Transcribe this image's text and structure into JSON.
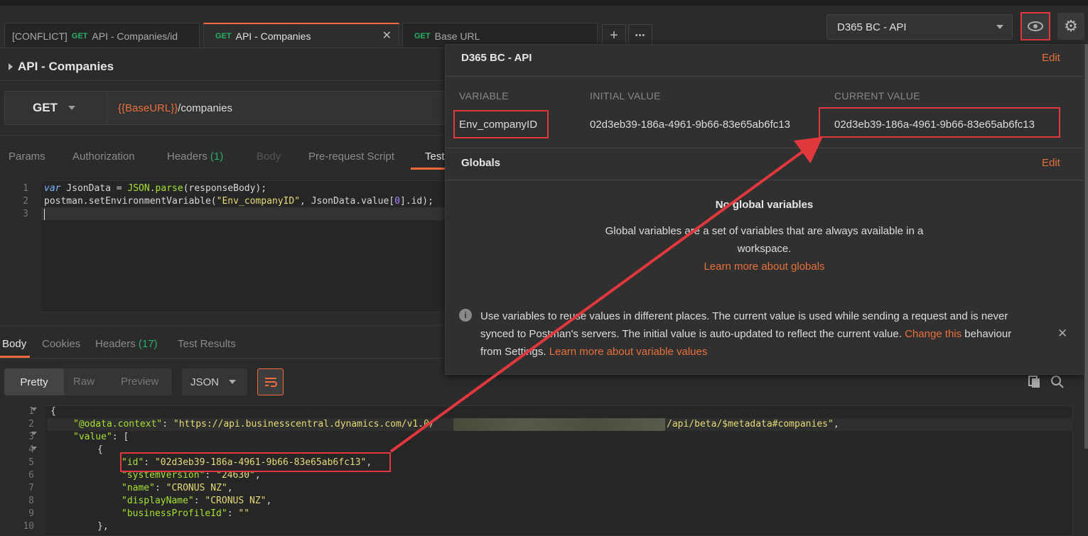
{
  "tabs": [
    {
      "prefix": "[CONFLICT]",
      "method": "GET",
      "label": "API - Companies/id",
      "active": false
    },
    {
      "prefix": "",
      "method": "GET",
      "label": "API - Companies",
      "active": true
    },
    {
      "prefix": "",
      "method": "GET",
      "label": "Base URL",
      "active": false
    }
  ],
  "tab_actions": {
    "add": "+",
    "more": "•••",
    "close": "✕"
  },
  "environment": {
    "selected": "D365 BC - API"
  },
  "request": {
    "title": "API - Companies",
    "method": "GET",
    "url_var": "{{BaseURL}}",
    "url_path": "/companies"
  },
  "request_tabs": {
    "params": "Params",
    "authorization": "Authorization",
    "headers": "Headers",
    "headers_count": "(1)",
    "body": "Body",
    "prerequest": "Pre-request Script",
    "tests": "Tests"
  },
  "test_script": {
    "line_numbers": [
      "1",
      "2",
      "3"
    ],
    "line1_kw": "var",
    "line1_var": " JsonData = ",
    "line1_json": "JSON",
    "line1_dot": ".",
    "line1_fn": "parse",
    "line1_rest": "(responseBody);",
    "line2_a": "postman.setEnvironmentVariable(",
    "line2_str": "\"Env_companyID\"",
    "line2_b": ", JsonData.value[",
    "line2_num": "0",
    "line2_c": "].id);"
  },
  "response_tabs": {
    "body": "Body",
    "cookies": "Cookies",
    "headers": "Headers",
    "headers_count": "(17)",
    "test_results": "Test Results"
  },
  "response_view": {
    "pretty": "Pretty",
    "raw": "Raw",
    "preview": "Preview",
    "format": "JSON"
  },
  "response_body": {
    "line_numbers": [
      "1",
      "2",
      "3",
      "4",
      "5",
      "6",
      "7",
      "8",
      "9",
      "10"
    ],
    "l1": "{",
    "l2_key": "\"@odata.context\"",
    "l2_colon": ": ",
    "l2_val_a": "\"https://api.businesscentral.dynamics.com/v1.0/",
    "l2_val_b": "/api/beta/$metadata#companies\"",
    "l2_end": ",",
    "l3_key": "\"value\"",
    "l3_rest": ": [",
    "l4": "{",
    "l5_key": "\"id\"",
    "l5_val": "\"02d3eb39-186a-4961-9b66-83e65ab6fc13\"",
    "l6_key": "\"systemVersion\"",
    "l6_val": "\"24630\"",
    "l7_key": "\"name\"",
    "l7_val": "\"CRONUS NZ\"",
    "l8_key": "\"displayName\"",
    "l8_val": "\"CRONUS NZ\"",
    "l9_key": "\"businessProfileId\"",
    "l9_val": "\"\"",
    "l10": "},"
  },
  "env_panel": {
    "title": "D365 BC - API",
    "edit": "Edit",
    "col_variable": "VARIABLE",
    "col_initial": "INITIAL VALUE",
    "col_current": "CURRENT VALUE",
    "var_name": "Env_companyID",
    "initial_value": "02d3eb39-186a-4961-9b66-83e65ab6fc13",
    "current_value": "02d3eb39-186a-4961-9b66-83e65ab6fc13",
    "globals_title": "Globals",
    "globals_edit": "Edit",
    "no_globals": "No global variables",
    "globals_desc_1": "Global variables are a set of variables that are always available in a",
    "globals_desc_2": "workspace.",
    "learn_globals": "Learn more about globals",
    "info_1": "Use variables to reuse values in different places. The current value is used while sending a request and is never",
    "info_2a": "synced to Postman's servers. The initial value is auto-updated to reflect the current value. ",
    "info_2_link": "Change this",
    "info_2b": " behaviour",
    "info_3a": "from Settings. ",
    "info_3_link": "Learn more about variable values",
    "info_close": "✕"
  },
  "colors": {
    "accent": "#f26b3a",
    "annotation_red": "#e0383c",
    "method_green": "#2bae66"
  }
}
